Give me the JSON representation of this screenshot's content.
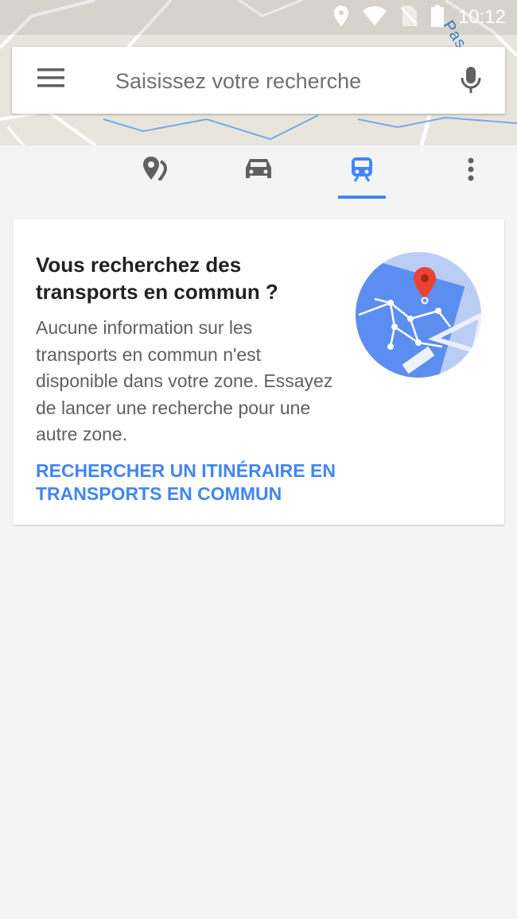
{
  "status_bar": {
    "time": "10:12",
    "icons": [
      "location-icon",
      "wifi-icon",
      "no-sim-icon",
      "battery-icon"
    ]
  },
  "map": {
    "label": "Passeau"
  },
  "search": {
    "placeholder": "Saisissez votre recherche",
    "value": "",
    "menu_icon": "hamburger-menu-icon",
    "mic_icon": "microphone-icon"
  },
  "tabs": [
    {
      "name": "explore",
      "icon": "place-pin-icon",
      "selected": false
    },
    {
      "name": "driving",
      "icon": "car-icon",
      "selected": false
    },
    {
      "name": "transit",
      "icon": "train-icon",
      "selected": true
    }
  ],
  "overflow_icon": "more-vert-icon",
  "card": {
    "title": "Vous recherchez des transports en commun ?",
    "body": "Aucune information sur les transports en commun n'est disponible dans votre zone. Essayez de lancer une recherche pour une autre zone.",
    "link": "RECHERCHER UN ITINÉRAIRE EN TRANSPORTS EN COMMUN",
    "illustration_icon": "transit-map-illustration"
  },
  "colors": {
    "accent": "#4285f4",
    "icon_gray": "#616161",
    "background": "#f4f4f4",
    "pin_red": "#ea4335"
  }
}
